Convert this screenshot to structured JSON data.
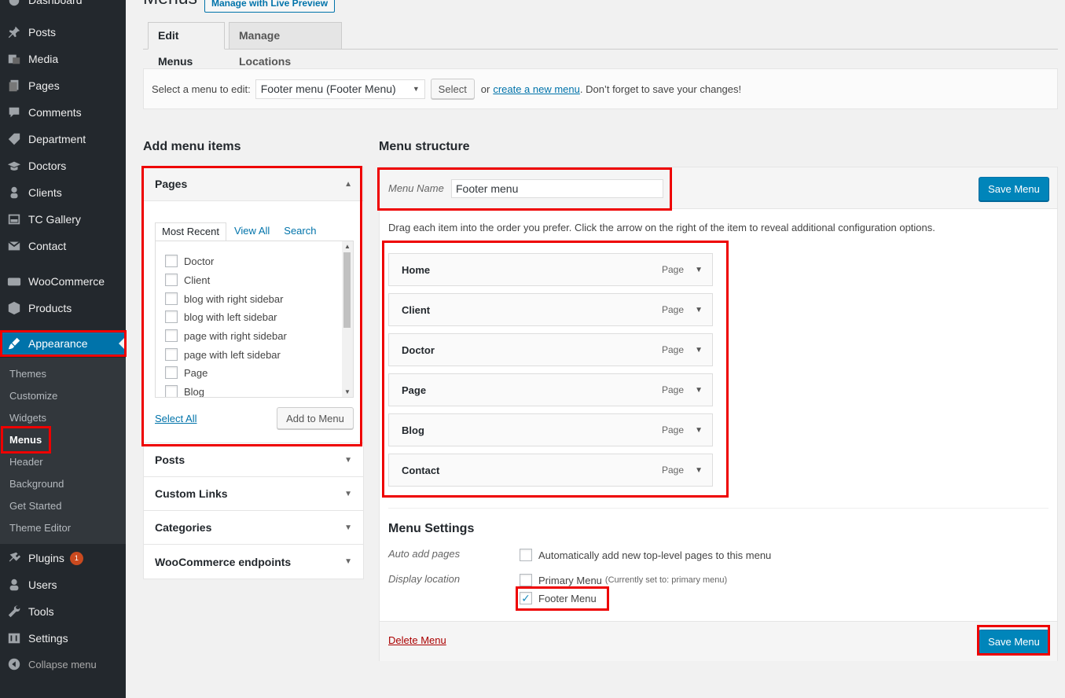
{
  "sidebar": {
    "items": [
      {
        "label": "Dashboard",
        "icon": "dashboard-icon"
      },
      {
        "label": "Posts",
        "icon": "pin-icon"
      },
      {
        "label": "Media",
        "icon": "media-icon"
      },
      {
        "label": "Pages",
        "icon": "pages-icon"
      },
      {
        "label": "Comments",
        "icon": "comment-icon"
      },
      {
        "label": "Department",
        "icon": "tag-icon"
      },
      {
        "label": "Doctors",
        "icon": "graduation-icon"
      },
      {
        "label": "Clients",
        "icon": "user-icon"
      },
      {
        "label": "TC Gallery",
        "icon": "gallery-icon"
      },
      {
        "label": "Contact",
        "icon": "mail-icon"
      },
      {
        "label": "WooCommerce",
        "icon": "woo-icon"
      },
      {
        "label": "Products",
        "icon": "box-icon"
      },
      {
        "label": "Appearance",
        "icon": "brush-icon"
      }
    ],
    "submenu": [
      "Themes",
      "Customize",
      "Widgets",
      "Menus",
      "Header",
      "Background",
      "Get Started",
      "Theme Editor"
    ],
    "bottom": [
      {
        "label": "Plugins",
        "icon": "plugin-icon",
        "badge": "1"
      },
      {
        "label": "Users",
        "icon": "user-icon"
      },
      {
        "label": "Tools",
        "icon": "wrench-icon"
      },
      {
        "label": "Settings",
        "icon": "settings-icon"
      },
      {
        "label": "Collapse menu",
        "icon": "collapse-icon"
      }
    ]
  },
  "header": {
    "title": "Menus",
    "preview_button": "Manage with Live Preview",
    "tabs": [
      "Edit Menus",
      "Manage Locations"
    ]
  },
  "select_bar": {
    "label": "Select a menu to edit:",
    "selected": "Footer menu (Footer Menu)",
    "select_button": "Select",
    "or_text": "or",
    "create_link": "create a new menu",
    "suffix": ". Don’t forget to save your changes!"
  },
  "add_items": {
    "title": "Add menu items",
    "pages_title": "Pages",
    "inner_tabs": [
      "Most Recent",
      "View All",
      "Search"
    ],
    "pages": [
      "Doctor",
      "Client",
      "blog with right sidebar",
      "blog with left sidebar",
      "page with right sidebar",
      "page with left sidebar",
      "Page",
      "Blog"
    ],
    "select_all": "Select All",
    "add_button": "Add to Menu",
    "other_sections": [
      "Posts",
      "Custom Links",
      "Categories",
      "WooCommerce endpoints"
    ]
  },
  "structure": {
    "title": "Menu structure",
    "menu_name_label": "Menu Name",
    "menu_name_value": "Footer menu",
    "save_button": "Save Menu",
    "instructions": "Drag each item into the order you prefer. Click the arrow on the right of the item to reveal additional configuration options.",
    "items": [
      {
        "label": "Home",
        "type": "Page"
      },
      {
        "label": "Client",
        "type": "Page"
      },
      {
        "label": "Doctor",
        "type": "Page"
      },
      {
        "label": "Page",
        "type": "Page"
      },
      {
        "label": "Blog",
        "type": "Page"
      },
      {
        "label": "Contact",
        "type": "Page"
      }
    ],
    "settings_title": "Menu Settings",
    "auto_add_label": "Auto add pages",
    "auto_add_text": "Automatically add new top-level pages to this menu",
    "display_location_label": "Display location",
    "primary_menu": "Primary Menu",
    "primary_note": "(Currently set to: primary menu)",
    "footer_menu": "Footer Menu",
    "delete_link": "Delete Menu"
  },
  "colors": {
    "admin_bg": "#23282d",
    "accent": "#0073aa",
    "highlight_box": "#ee0000"
  }
}
